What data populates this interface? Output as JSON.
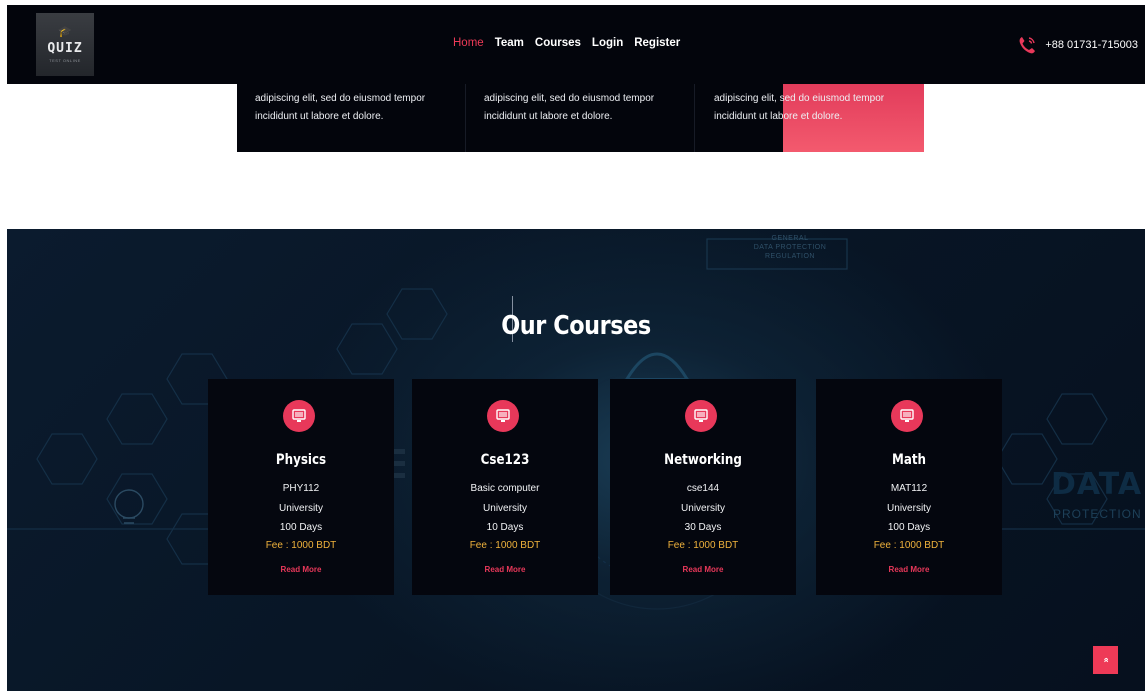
{
  "header": {
    "logo": {
      "text": "QUIZ",
      "subtext": "TEST ONLINE"
    },
    "nav": [
      {
        "label": "Home",
        "active": true
      },
      {
        "label": "Team",
        "active": false
      },
      {
        "label": "Courses",
        "active": false
      },
      {
        "label": "Login",
        "active": false
      },
      {
        "label": "Register",
        "active": false
      }
    ],
    "phone": {
      "icon": "phone-icon",
      "number": "+88 01731-715003"
    }
  },
  "features": [
    {
      "line1": "adipiscing elit, sed do eiusmod tempor",
      "line2": "incididunt ut labore et dolore."
    },
    {
      "line1": "adipiscing elit, sed do eiusmod tempor",
      "line2": "incididunt ut labore et dolore."
    },
    {
      "line1": "adipiscing elit, sed do eiusmod tempor",
      "line2": "incididunt ut labore et dolore."
    }
  ],
  "courses_section": {
    "title": "Our Courses",
    "background_text": {
      "gdpr_lines": [
        "GENERAL",
        "DATA PROTECTION",
        "REGULATION"
      ],
      "data": "DATA",
      "protection": "PROTECTION"
    },
    "cards": [
      {
        "icon": "computer-icon",
        "name": "Physics",
        "code": "PHY112",
        "level": "University",
        "duration": "100 Days",
        "fee": "Fee : 1000 BDT",
        "link": "Read More"
      },
      {
        "icon": "computer-icon",
        "name": "Cse123",
        "code": "Basic computer",
        "level": "University",
        "duration": "10 Days",
        "fee": "Fee : 1000 BDT",
        "link": "Read More"
      },
      {
        "icon": "computer-icon",
        "name": "Networking",
        "code": "cse144",
        "level": "University",
        "duration": "30 Days",
        "fee": "Fee : 1000 BDT",
        "link": "Read More"
      },
      {
        "icon": "computer-icon",
        "name": "Math",
        "code": "MAT112",
        "level": "University",
        "duration": "100 Days",
        "fee": "Fee : 1000 BDT",
        "link": "Read More"
      }
    ]
  },
  "scroll_top": {
    "icon": "double-chevron-up-icon",
    "symbol": "»"
  },
  "colors": {
    "accent": "#ee3a57",
    "fee": "#f0b23c",
    "header_bg": "#03050c",
    "card_bg": "#04060e"
  }
}
